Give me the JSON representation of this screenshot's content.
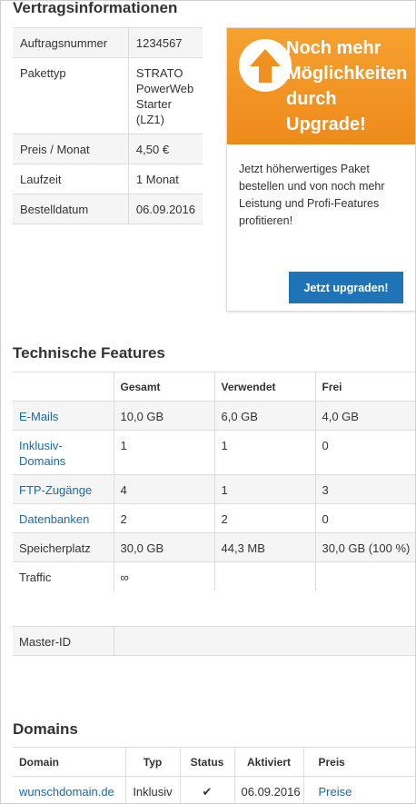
{
  "contract": {
    "heading": "Vertragsinformationen",
    "rows": [
      {
        "label": "Auftragsnummer",
        "value": "1234567"
      },
      {
        "label": "Pakettyp",
        "value": "STRATO PowerWeb Starter (LZ1)"
      },
      {
        "label": "Preis / Monat",
        "value": "4,50 €"
      },
      {
        "label": "Laufzeit",
        "value": "1 Monat"
      },
      {
        "label": "Bestelldatum",
        "value": "06.09.2016"
      }
    ]
  },
  "promo": {
    "title": "Noch mehr Möglichkeiten durch Upgrade!",
    "title_lines": [
      "Noch mehr",
      "Möglichkeiten",
      "durch",
      "Upgrade!"
    ],
    "text": "Jetzt höherwertiges Paket bestellen und von noch mehr Leistung und Profi-Features profitieren!",
    "button": "Jetzt upgraden!",
    "accent": "#f0901f",
    "button_color": "#1f74b8",
    "icon": "arrow-up-icon"
  },
  "features": {
    "heading": "Technische Features",
    "columns": [
      "",
      "Gesamt",
      "Verwendet",
      "Frei"
    ],
    "rows": [
      {
        "name": "E-Mails",
        "link": true,
        "total": "10,0 GB",
        "used": "6,0 GB",
        "free": "4,0 GB"
      },
      {
        "name": "Inklusiv-Domains",
        "link": true,
        "total": "1",
        "used": "1",
        "free": "0"
      },
      {
        "name": "FTP-Zugänge",
        "link": true,
        "total": "4",
        "used": "1",
        "free": "3"
      },
      {
        "name": "Datenbanken",
        "link": true,
        "total": "2",
        "used": "2",
        "free": "0"
      },
      {
        "name": "Speicherplatz",
        "link": false,
        "total": "30,0 GB",
        "used": "44,3 MB",
        "free": "30,0 GB (100 %)"
      },
      {
        "name": "Traffic",
        "link": false,
        "total": "∞",
        "used": "",
        "free": ""
      }
    ]
  },
  "master": {
    "label": "Master-ID",
    "value": ""
  },
  "domains": {
    "heading": "Domains",
    "columns": [
      "Domain",
      "Typ",
      "Status",
      "Aktiviert",
      "Preis"
    ],
    "rows": [
      {
        "domain": "wunschdomain.de",
        "type": "Inklusiv",
        "status": "✔",
        "activated": "06.09.2016",
        "price": "Preise"
      }
    ]
  },
  "colors": {
    "link": "#1a6aa8",
    "border": "#dddddd",
    "stripe": "#f5f5f5"
  }
}
